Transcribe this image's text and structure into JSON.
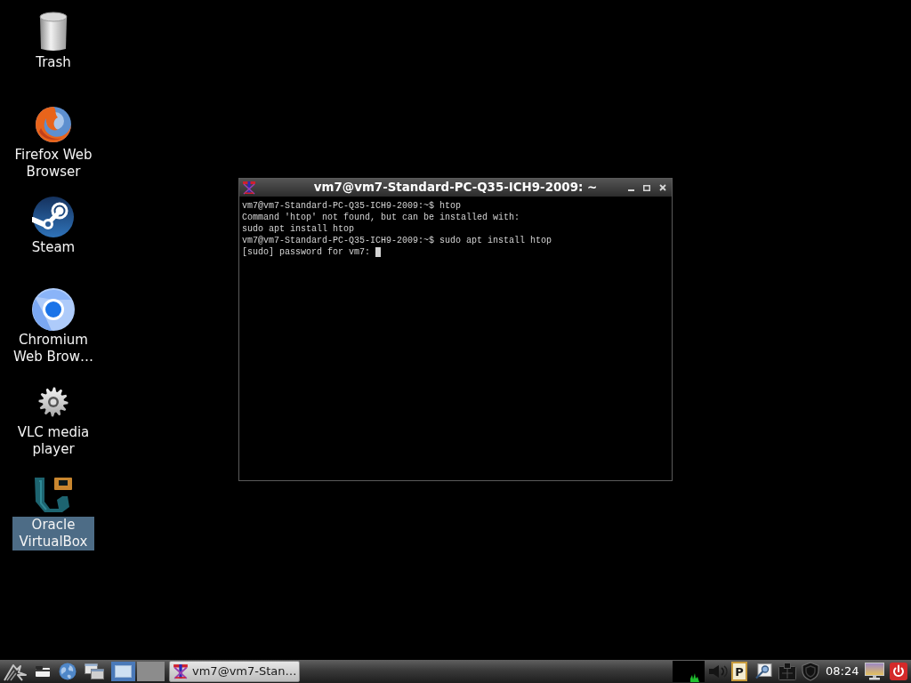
{
  "desktop": {
    "icons": [
      {
        "kind": "trash",
        "label": "Trash",
        "selected": false
      },
      {
        "kind": "firefox",
        "label": "Firefox Web Browser",
        "selected": false
      },
      {
        "kind": "steam",
        "label": "Steam",
        "selected": false
      },
      {
        "kind": "chromium",
        "label": "Chromium Web Brow…",
        "selected": false
      },
      {
        "kind": "vlc",
        "label": "VLC media player",
        "selected": false
      },
      {
        "kind": "virtualbox",
        "label": "Oracle VirtualBox",
        "selected": true
      }
    ]
  },
  "terminal": {
    "title": "vm7@vm7-Standard-PC-Q35-ICH9-2009: ~",
    "lines": [
      "vm7@vm7-Standard-PC-Q35-ICH9-2009:~$ htop",
      "Command 'htop' not found, but can be installed with:",
      "sudo apt install htop",
      "vm7@vm7-Standard-PC-Q35-ICH9-2009:~$ sudo apt install htop",
      "[sudo] password for vm7:"
    ],
    "cursor": true
  },
  "taskbar": {
    "workspaces": [
      {
        "selected": true
      },
      {
        "selected": false
      }
    ],
    "tasks": [
      {
        "label": "vm7@vm7-Stan…",
        "selected": false
      }
    ],
    "indicator_letter": "P",
    "clock": "08:24"
  }
}
